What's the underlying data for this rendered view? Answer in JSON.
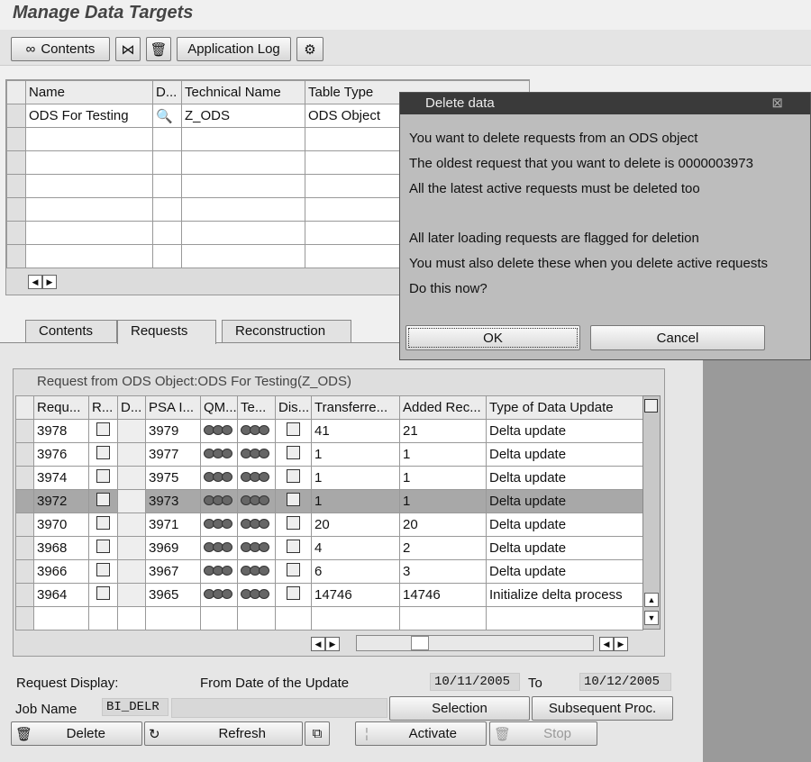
{
  "page_title": "Manage Data Targets",
  "toolbar": {
    "contents": "Contents",
    "application_log": "Application Log"
  },
  "upper_table": {
    "headers": [
      "Name",
      "D...",
      "Technical Name",
      "Table Type"
    ],
    "rows": [
      {
        "name": "ODS For Testing",
        "technical_name": "Z_ODS",
        "table_type": "ODS Object"
      }
    ]
  },
  "tabs": [
    "Contents",
    "Requests",
    "Reconstruction"
  ],
  "requests": {
    "caption": "Request from ODS Object:ODS For Testing(Z_ODS)",
    "headers": [
      "Requ...",
      "R...",
      "D...",
      "PSA I...",
      "QM...",
      "Te...",
      "Dis...",
      "Transferre...",
      "Added Rec...",
      "Type of Data Update"
    ],
    "rows": [
      {
        "req": "3978",
        "psa": "3979",
        "transferred": "41",
        "added": "21",
        "type": "Delta update"
      },
      {
        "req": "3976",
        "psa": "3977",
        "transferred": "1",
        "added": "1",
        "type": "Delta update"
      },
      {
        "req": "3974",
        "psa": "3975",
        "transferred": "1",
        "added": "1",
        "type": "Delta update"
      },
      {
        "req": "3972",
        "psa": "3973",
        "transferred": "1",
        "added": "1",
        "type": "Delta update"
      },
      {
        "req": "3970",
        "psa": "3971",
        "transferred": "20",
        "added": "20",
        "type": "Delta update"
      },
      {
        "req": "3968",
        "psa": "3969",
        "transferred": "4",
        "added": "2",
        "type": "Delta update"
      },
      {
        "req": "3966",
        "psa": "3967",
        "transferred": "6",
        "added": "3",
        "type": "Delta update"
      },
      {
        "req": "3964",
        "psa": "3965",
        "transferred": "14746",
        "added": "14746",
        "type": "Initialize delta process"
      }
    ]
  },
  "bottom": {
    "request_display": "Request Display:",
    "from_date_label": "From Date of the Update",
    "from_date": "10/11/2005",
    "to_label": "To",
    "to_date": "10/12/2005",
    "job_name_label": "Job Name",
    "job_name": "BI_DELR",
    "selection": "Selection",
    "subsequent": "Subsequent Proc.",
    "delete": "Delete",
    "refresh": "Refresh",
    "activate": "Activate",
    "stop": "Stop"
  },
  "dialog": {
    "title": "Delete data",
    "lines": [
      "You want to delete requests from an ODS object",
      "The oldest request that you want to delete is 0000003973",
      "All the latest active requests must be deleted too",
      "All later loading requests are flagged for deletion",
      "You must also delete these when you delete active requests",
      "Do this now?"
    ],
    "ok": "OK",
    "cancel": "Cancel"
  }
}
